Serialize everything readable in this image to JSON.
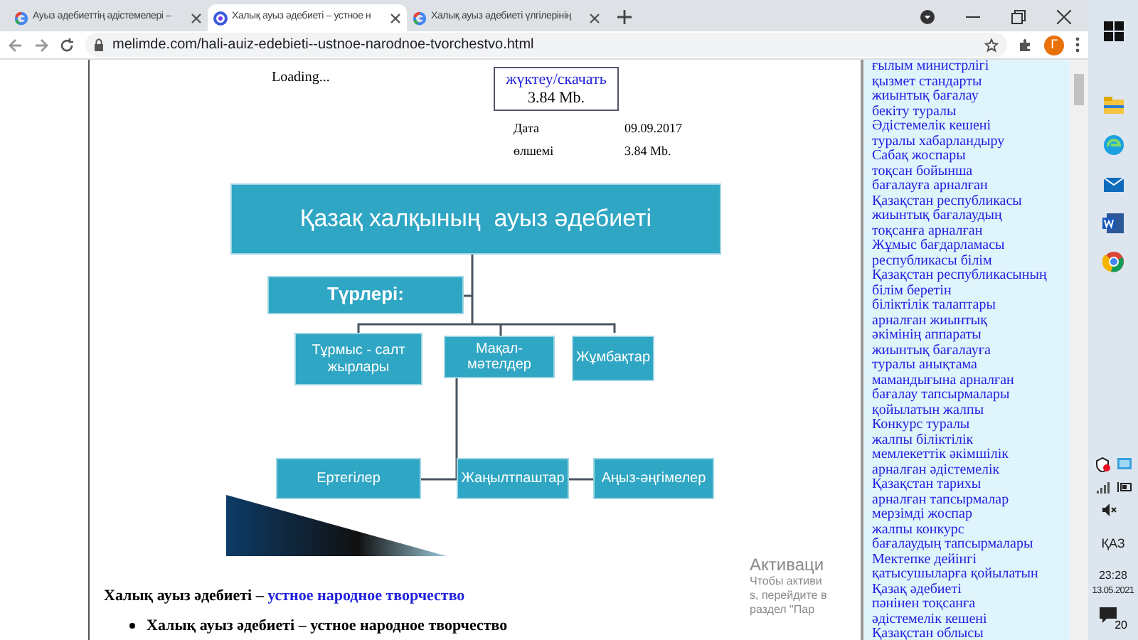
{
  "browser": {
    "tabs": [
      {
        "title": "Ауыз әдебиеттің әдістемелері –",
        "kind": "google",
        "selected": false
      },
      {
        "title": "Халық ауыз әдебиеті – устное н",
        "kind": "site",
        "selected": true
      },
      {
        "title": "Халық ауыз әдебиеті үлгілерінің",
        "kind": "google",
        "selected": false
      }
    ],
    "address": "melimde.com/hali-auiz-edebieti--ustnoe-narodnoe-tvorchestvo.html",
    "profile_initial": "Г"
  },
  "page": {
    "loading": "Loading...",
    "download": {
      "link": "жүктеу/скачать",
      "size": "3.84 Mb."
    },
    "details": [
      {
        "label": "Дата",
        "value": "09.09.2017"
      },
      {
        "label": "өлшемі",
        "value": "3.84 Mb."
      }
    ],
    "diagram": {
      "title": "Қазақ халқының  ауыз әдебиеті",
      "types_label": "Түрлері:",
      "genres": [
        "Тұрмыс - салт жырлары",
        "Мақал-мәтелдер",
        "Жұмбақтар"
      ],
      "more_genres": [
        "Ертегілер",
        "Жаңылтпаштар",
        "Аңыз-әңгімелер"
      ]
    },
    "intro": {
      "term": "Халық ауыз әдебиеті –",
      "link": "устное народное творчество"
    },
    "bullets": [
      "Халық ауыз әдебиеті – устное народное творчество"
    ]
  },
  "sidebar": {
    "links": [
      "ғылым министрлігі",
      "қызмет стандарты",
      "жиынтық бағалау",
      "бекіту туралы",
      "Әдістемелік кешені",
      "туралы хабарландыру",
      "Сабақ жоспары",
      "тоқсан бойынша",
      "бағалауға арналған",
      "Қазақстан республикасы",
      "жиынтық бағалаудың",
      "тоқсанға арналған",
      "Жұмыс бағдарламасы",
      "республикасы білім",
      "Қазақстан республикасының",
      "білім беретін",
      "біліктілік талаптары",
      "арналған жиынтық",
      "әкімінің аппараты",
      "жиынтық бағалауға",
      "туралы анықтама",
      "мамандығына арналған",
      "бағалау тапсырмалары",
      "қойылатын жалпы",
      "Конкурс туралы",
      "жалпы біліктілік",
      "мемлекеттік әкімшілік",
      "арналған әдістемелік",
      "Қазақстан тарихы",
      "арналған тапсырмалар",
      "мерзімді жоспар",
      "жалпы конкурс",
      "бағалаудың тапсырмалары",
      "Мектепке дейінгі",
      "қатысушыларға қойылатын",
      "Қазақ әдебиеті",
      "пәнінен тоқсанға",
      "әдістемелік кешені",
      "Қазақстан облысы"
    ]
  },
  "activation": {
    "title": "Активаци",
    "line_1_start": "Чтобы активи",
    "line_1_end": "s, перейдите в",
    "line_2": "раздел \"Пар"
  },
  "taskbar": {
    "language": "ҚАЗ",
    "time": "23:28",
    "date": "13.05.2021",
    "notifications": "20"
  }
}
